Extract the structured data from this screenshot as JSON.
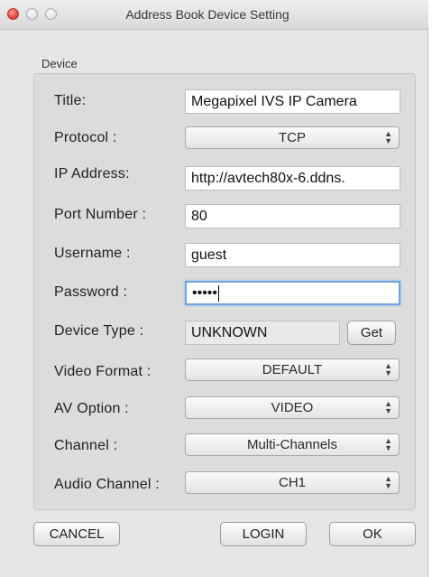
{
  "window": {
    "title": "Address Book Device Setting"
  },
  "group": {
    "title": "Device"
  },
  "fields": {
    "title": {
      "label": "Title:",
      "value": "Megapixel IVS IP Camera"
    },
    "protocol": {
      "label": "Protocol :",
      "value": "TCP"
    },
    "ip": {
      "label": "IP Address:",
      "value": "http://avtech80x-6.ddns."
    },
    "port": {
      "label": "Port Number :",
      "value": "80"
    },
    "username": {
      "label": "Username :",
      "value": "guest"
    },
    "password": {
      "label": "Password :",
      "value": "•••••"
    },
    "device_type": {
      "label": "Device Type :",
      "value": "UNKNOWN",
      "button": "Get"
    },
    "video_format": {
      "label": "Video Format :",
      "value": "DEFAULT"
    },
    "av_option": {
      "label": "AV Option :",
      "value": "VIDEO"
    },
    "channel": {
      "label": "Channel :",
      "value": "Multi-Channels"
    },
    "audio_channel": {
      "label": "Audio Channel :",
      "value": "CH1"
    }
  },
  "buttons": {
    "cancel": "CANCEL",
    "login": "LOGIN",
    "ok": "OK"
  },
  "icons": {
    "select_arrows": "⌃⌄"
  },
  "colors": {
    "focus_ring": "#6ea3df",
    "close_button": "#e2463d"
  }
}
